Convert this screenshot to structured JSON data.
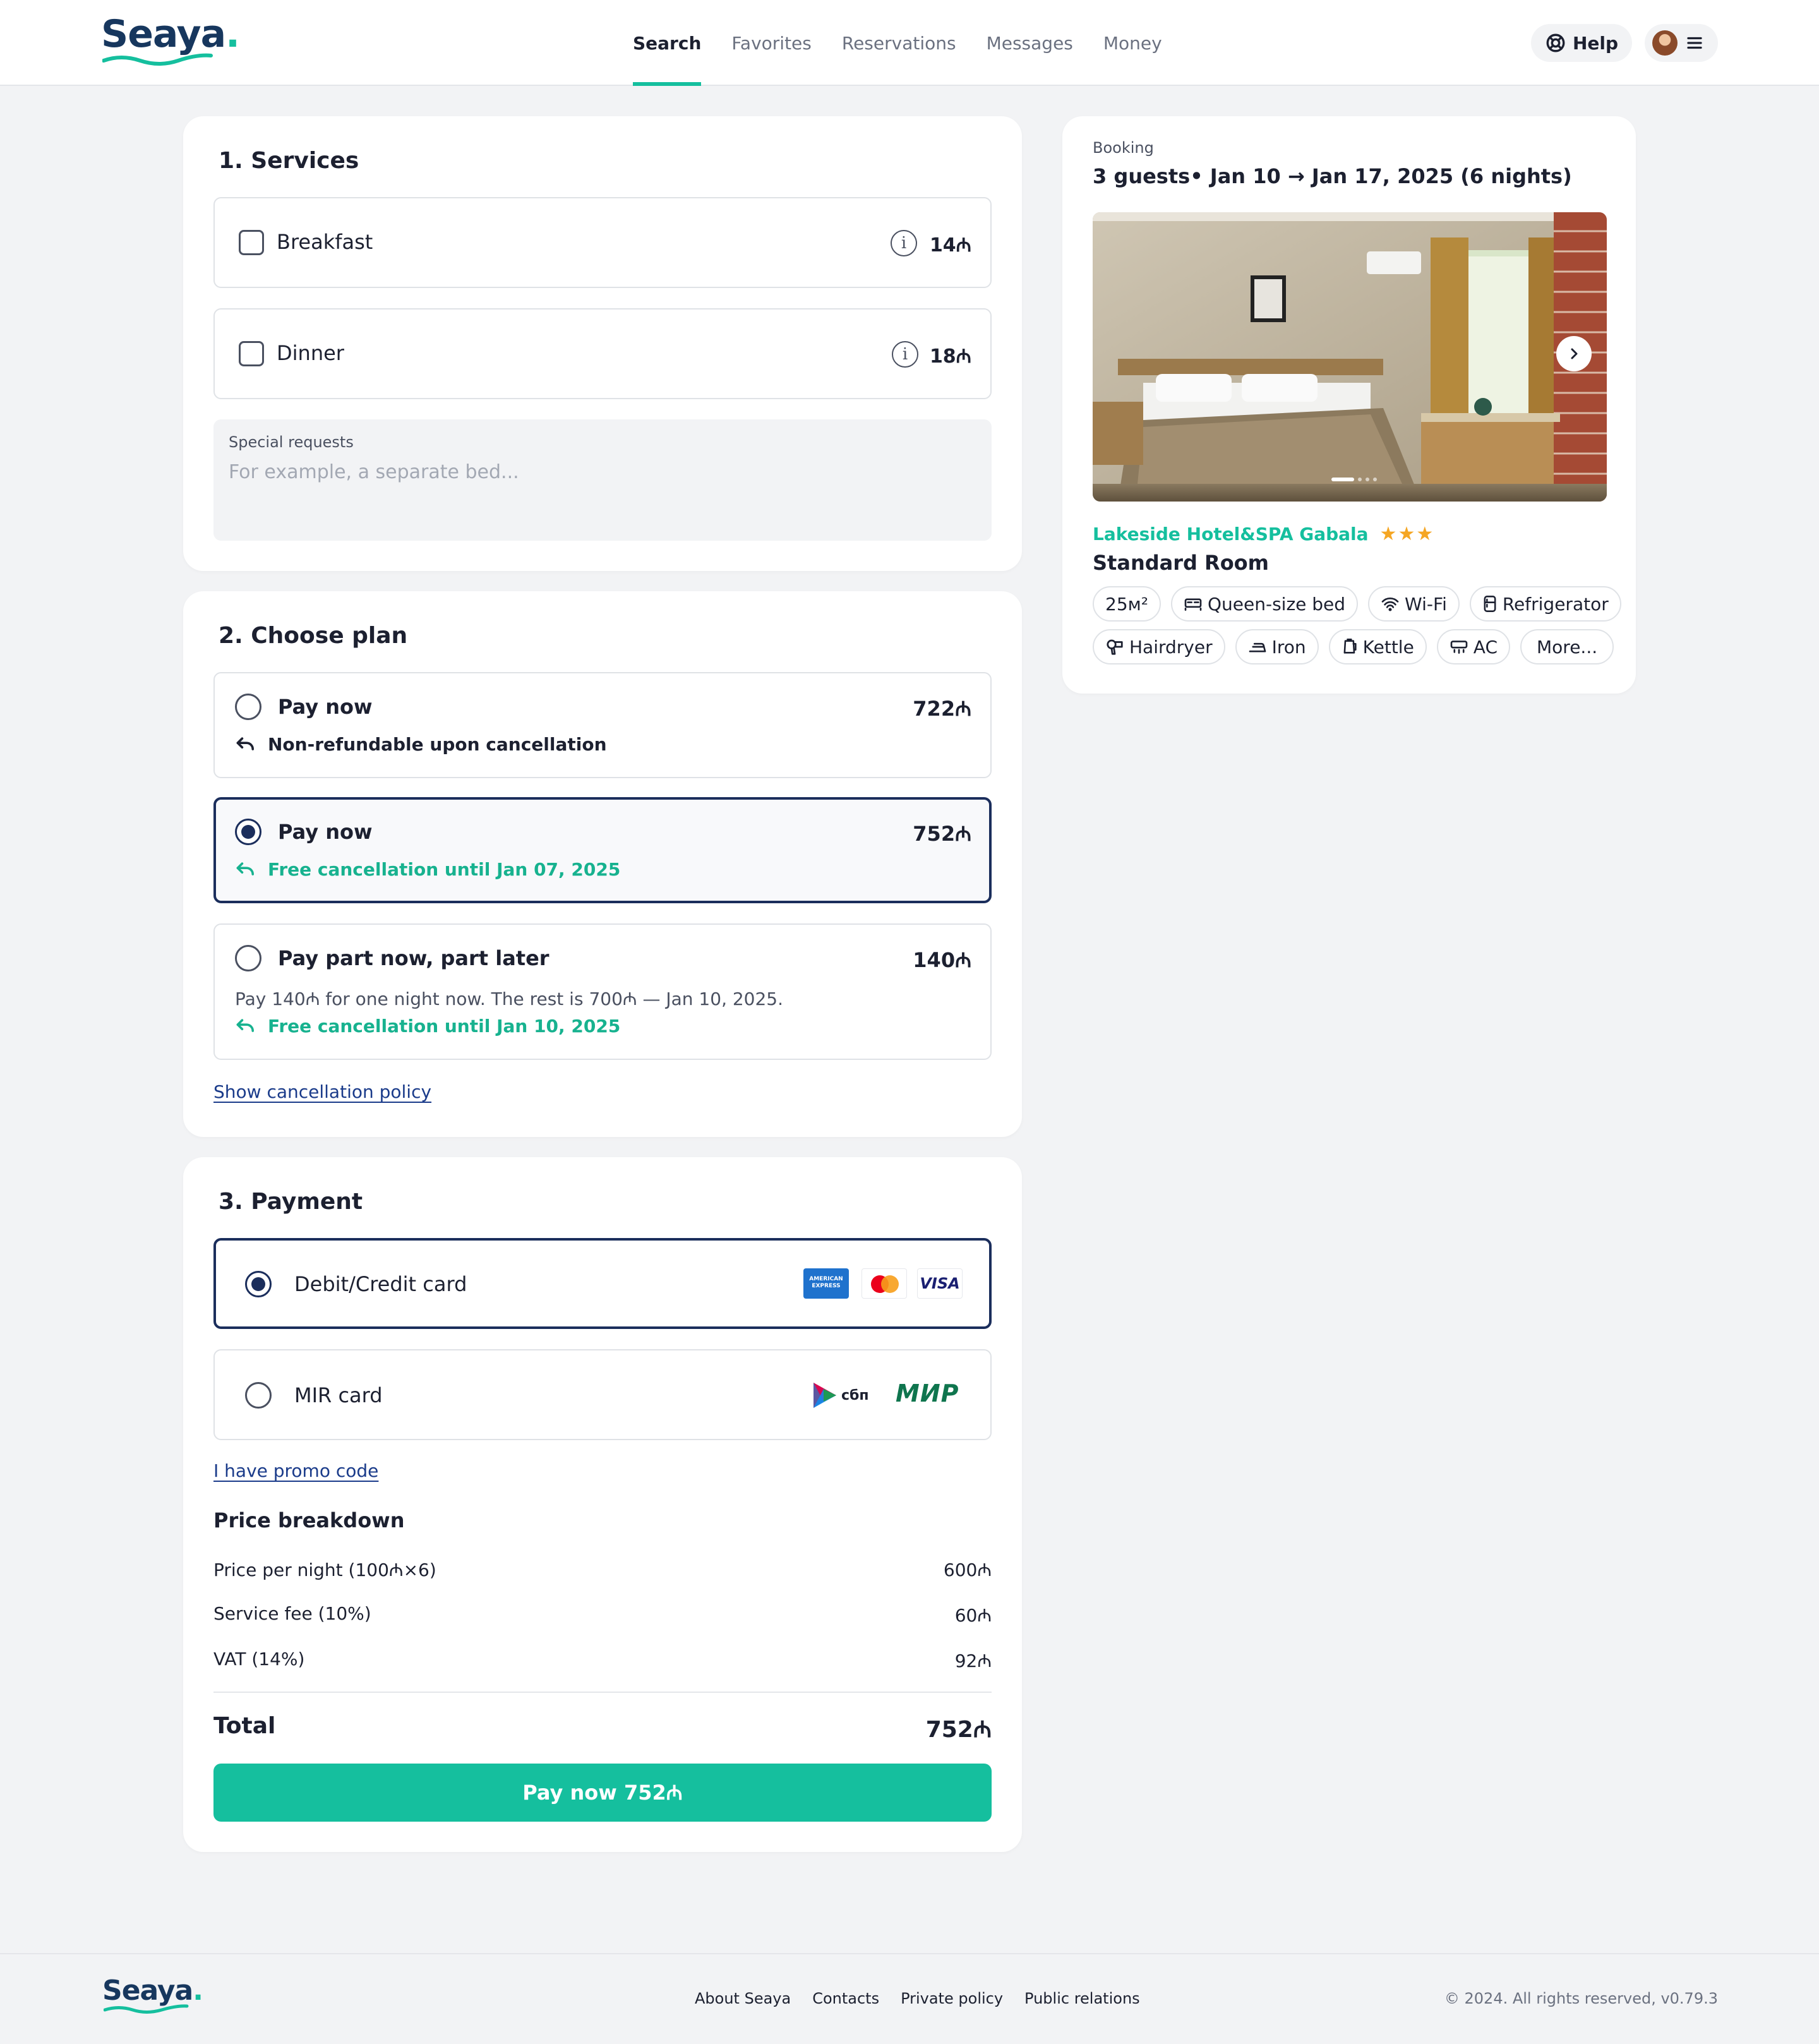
{
  "header": {
    "logo": "Seaya",
    "nav": [
      {
        "label": "Search",
        "active": true
      },
      {
        "label": "Favorites",
        "active": false
      },
      {
        "label": "Reservations",
        "active": false
      },
      {
        "label": "Messages",
        "active": false
      },
      {
        "label": "Money",
        "active": false
      }
    ],
    "help_label": "Help",
    "icons": {
      "help": "lifebuoy-icon",
      "menu": "hamburger-menu-icon"
    }
  },
  "services": {
    "title": "1. Services",
    "items": [
      {
        "label": "Breakfast",
        "price": "14₼",
        "checked": false
      },
      {
        "label": "Dinner",
        "price": "18₼",
        "checked": false
      }
    ],
    "special_requests": {
      "label": "Special requests",
      "placeholder": "For example, a separate bed..."
    }
  },
  "plan": {
    "title": "2. Choose plan",
    "options": [
      {
        "label": "Pay now",
        "price": "722₼",
        "note": "Non-refundable upon cancellation",
        "selected": false
      },
      {
        "label": "Pay now",
        "price": "752₼",
        "note": "Free cancellation until Jan 07, 2025",
        "selected": true
      },
      {
        "label": "Pay part now, part later",
        "price": "140₼",
        "desc": "Pay 140₼ for one night now. The rest is 700₼ — Jan 10, 2025.",
        "note": "Free cancellation until Jan 10, 2025",
        "selected": false
      }
    ],
    "policy_link": "Show cancellation policy"
  },
  "payment": {
    "title": "3. Payment",
    "methods": [
      {
        "label": "Debit/Credit card",
        "selected": true,
        "logos": [
          "AMERICAN EXPRESS",
          "mastercard",
          "VISA"
        ]
      },
      {
        "label": "MIR card",
        "selected": false,
        "logos": [
          "сбп",
          "МИР"
        ]
      }
    ],
    "promo_link": "I have promo code",
    "breakdown_title": "Price breakdown",
    "breakdown": [
      {
        "label": "Price per night (100₼×6)",
        "value": "600₼"
      },
      {
        "label": "Service fee (10%)",
        "value": "60₼"
      },
      {
        "label": "VAT (14%)",
        "value": "92₼"
      }
    ],
    "total_label": "Total",
    "total_value": "752₼",
    "pay_button": "Pay now 752₼"
  },
  "booking": {
    "label": "Booking",
    "summary": "3 guests• Jan 10 → Jan 17, 2025 (6 nights)",
    "photo_count": 4,
    "photo_index": 1,
    "hotel_name": "Lakeside Hotel&SPA Gabala",
    "stars": "★★★",
    "room_type": "Standard Room",
    "amenities_row1": [
      {
        "label": "25м²",
        "icon": ""
      },
      {
        "label": "Queen-size bed",
        "icon": "bed-icon"
      },
      {
        "label": "Wi-Fi",
        "icon": "wifi-icon"
      },
      {
        "label": "Refrigerator",
        "icon": "refrigerator-icon"
      }
    ],
    "amenities_row2": [
      {
        "label": "Hairdryer",
        "icon": "hairdryer-icon"
      },
      {
        "label": "Iron",
        "icon": "iron-icon"
      },
      {
        "label": "Kettle",
        "icon": "kettle-icon"
      },
      {
        "label": "AC",
        "icon": "ac-icon"
      },
      {
        "label": "More...",
        "icon": ""
      }
    ]
  },
  "footer": {
    "logo": "Seaya",
    "links": [
      "About Seaya",
      "Contacts",
      "Private policy",
      "Public relations"
    ],
    "copyright": "© 2024. All rights reserved, v0.79.3"
  },
  "colors": {
    "accent": "#15bf9e",
    "navy": "#1b2e5c",
    "link": "#1a3b8a",
    "star": "#f5a623"
  }
}
